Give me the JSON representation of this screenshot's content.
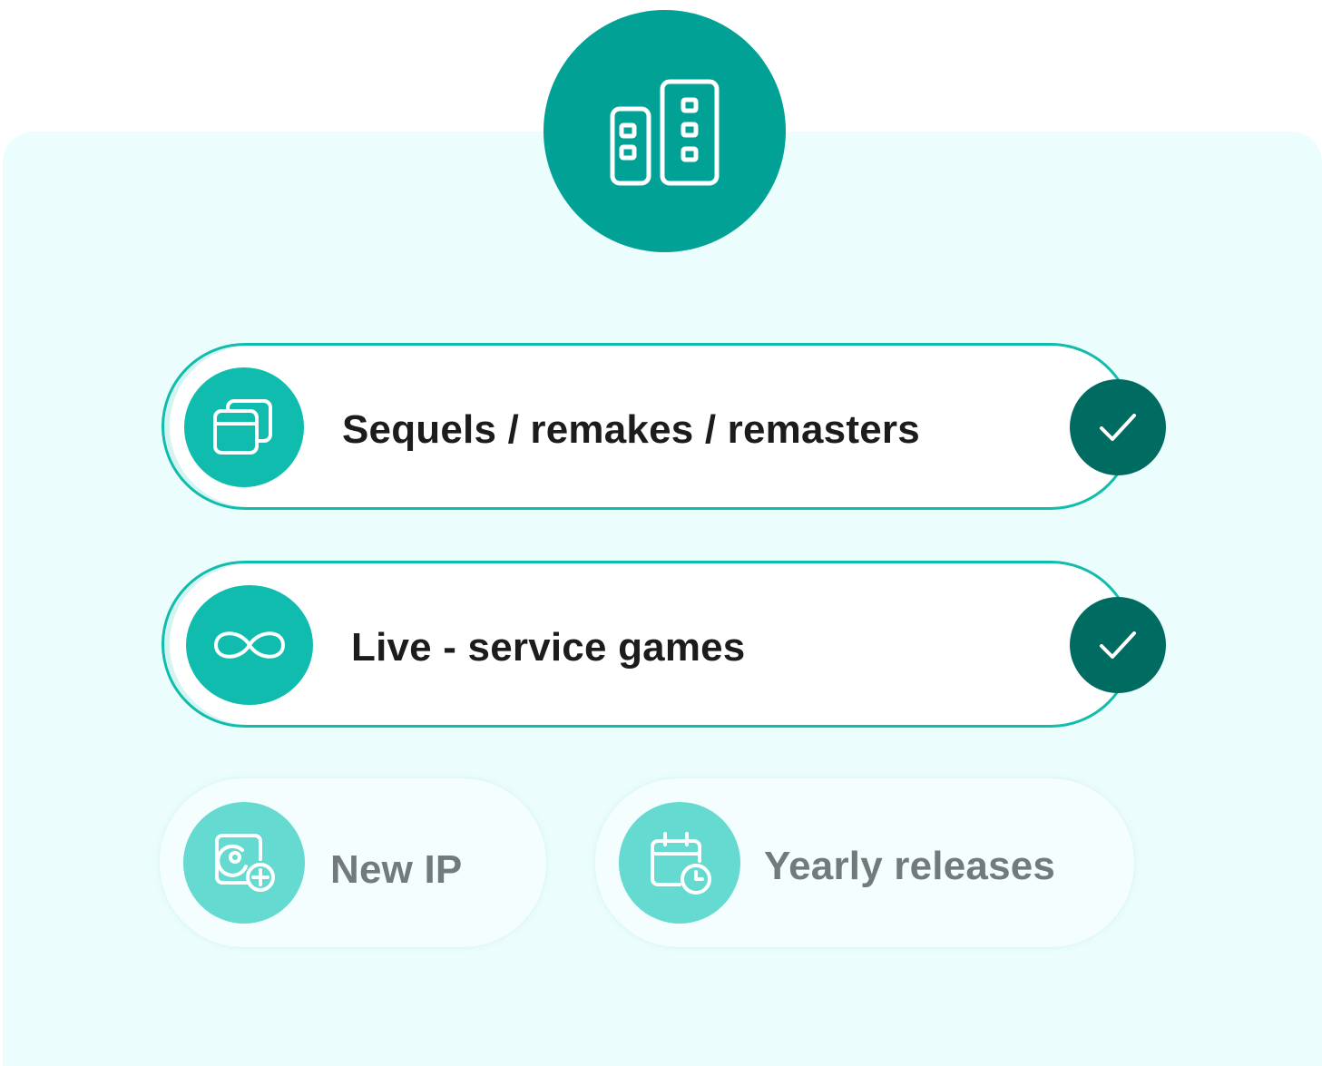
{
  "colors": {
    "primary": "#01a196",
    "accent": "#0fbcad",
    "check": "#006c61",
    "inactive_icon": "#65dad0",
    "panel": "#ebfdfd"
  },
  "header": {
    "icon": "buildings-icon"
  },
  "options": [
    {
      "label": "Sequels / remakes / remasters",
      "icon": "layers-icon",
      "selected": true
    },
    {
      "label": "Live - service games",
      "icon": "infinity-icon",
      "selected": true
    },
    {
      "label": "New IP",
      "icon": "disc-add-icon",
      "selected": false
    },
    {
      "label": "Yearly releases",
      "icon": "calendar-clock-icon",
      "selected": false
    }
  ]
}
